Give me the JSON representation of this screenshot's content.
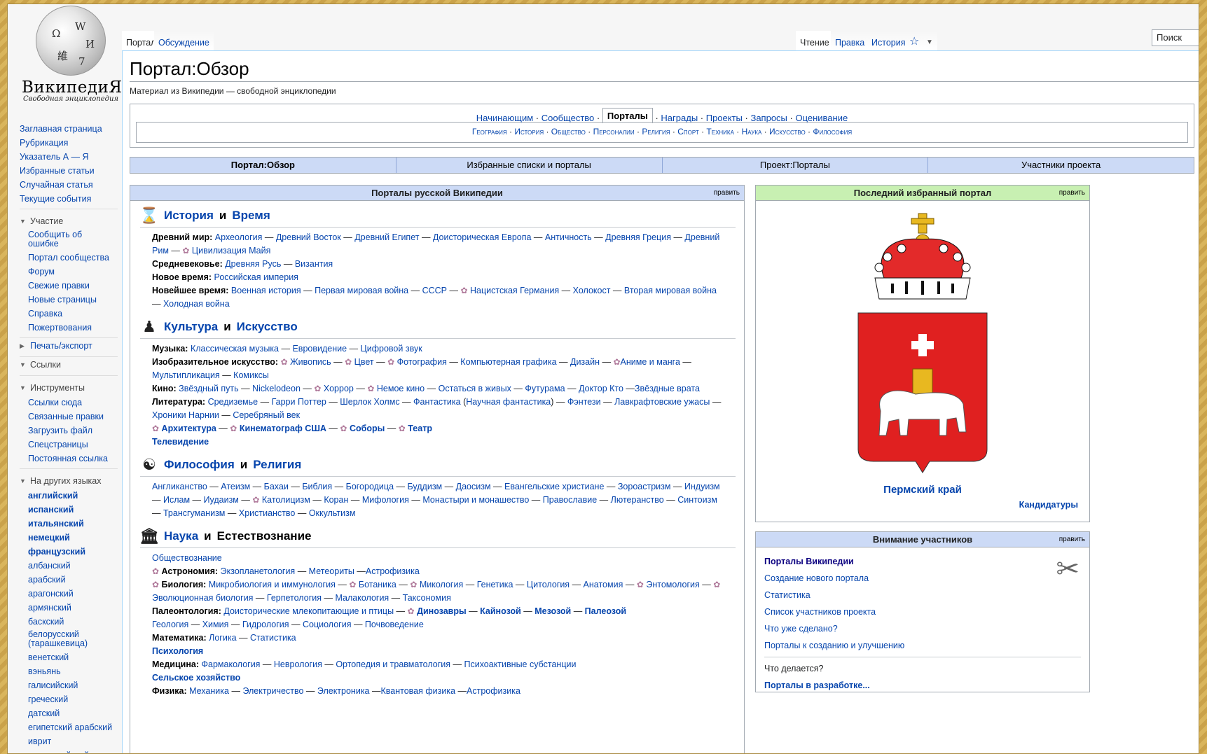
{
  "logo": {
    "title": "ВикипедиЯ",
    "subtitle": "Свободная энциклопедия"
  },
  "nav": [
    "Заглавная страница",
    "Рубрикация",
    "Указатель А — Я",
    "Избранные статьи",
    "Случайная статья",
    "Текущие события"
  ],
  "participate": {
    "title": "Участие",
    "items": [
      "Сообщить об ошибке",
      "Портал сообщества",
      "Форум",
      "Свежие правки",
      "Новые страницы",
      "Справка",
      "Пожертвования"
    ]
  },
  "print": {
    "title": "Печать/экспорт"
  },
  "links": {
    "title": "Ссылки"
  },
  "tools": {
    "title": "Инструменты",
    "items": [
      "Ссылки сюда",
      "Связанные правки",
      "Загрузить файл",
      "Спецстраницы",
      "Постоянная ссылка"
    ]
  },
  "langs": {
    "title": "На других языках",
    "bold": [
      "английский",
      "испанский",
      "итальянский",
      "немецкий",
      "французский"
    ],
    "items": [
      "албанский",
      "арабский",
      "арагонский",
      "армянский",
      "баскский",
      "белорусский (тарашкевица)",
      "венетский",
      "вэньянь",
      "галисийский",
      "греческий",
      "датский",
      "египетский арабский",
      "иврит",
      "индонезийский"
    ]
  },
  "tabs": {
    "portal": "Портал",
    "talk": "Обсуждение",
    "read": "Чтение",
    "edit": "Правка",
    "history": "История",
    "search_placeholder": "Поиск"
  },
  "page": {
    "title": "Портал:Обзор",
    "tagline": "Материал из Википедии — свободной энциклопедии"
  },
  "topnav": {
    "row1": [
      "Начинающим",
      "Сообщество"
    ],
    "current": "Порталы",
    "row1b": [
      "Награды",
      "Проекты",
      "Запросы",
      "Оценивание"
    ],
    "row2": [
      "География",
      "История",
      "Общество",
      "Персоналии",
      "Религия",
      "Спорт",
      "Техника",
      "Наука",
      "Искусство",
      "Философия"
    ]
  },
  "bar": [
    "Портал:Обзор",
    "Избранные списки и порталы",
    "Проект:Порталы",
    "Участники проекта"
  ],
  "left": {
    "title": "Порталы русской Википедии",
    "edit": "править",
    "s1": {
      "a": "История",
      "and": "и",
      "b": "Время"
    },
    "s2": {
      "a": "Культура",
      "and": "и",
      "b": "Искусство"
    },
    "s3": {
      "a": "Философия",
      "and": "и",
      "b": "Религия"
    },
    "s4": {
      "a": "Наука",
      "and": "и",
      "b": "Естествознание"
    }
  },
  "right": {
    "title": "Последний избранный портал",
    "edit": "править",
    "portal": "Пермский край",
    "cand": "Кандидатуры",
    "attn": "Внимание участников",
    "attn_edit": "править",
    "links": [
      "Порталы Википедии",
      "Создание нового портала",
      "Статистика",
      "Список участников проекта",
      "Что уже сделано?",
      "Порталы к созданию и улучшению"
    ],
    "progress": "Что делается?",
    "progress_b": "Порталы в разработке..."
  }
}
